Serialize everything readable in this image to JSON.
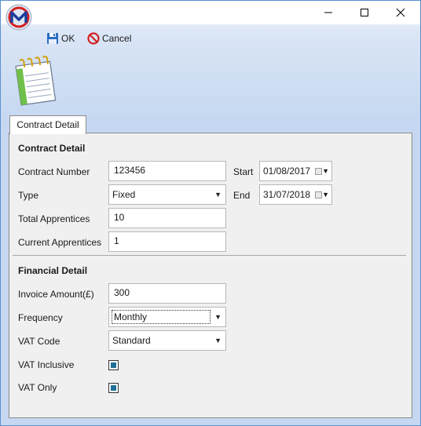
{
  "window": {
    "tab_label": "Contract Detail"
  },
  "toolbar": {
    "ok_label": "OK",
    "cancel_label": "Cancel"
  },
  "contract": {
    "section_title": "Contract Detail",
    "number_label": "Contract Number",
    "number_value": "123456",
    "type_label": "Type",
    "type_value": "Fixed",
    "total_label": "Total Apprentices",
    "total_value": "10",
    "current_label": "Current Apprentices",
    "current_value": "1",
    "start_label": "Start",
    "start_value": "01/08/2017",
    "end_label": "End",
    "end_value": "31/07/2018"
  },
  "financial": {
    "section_title": "Financial Detail",
    "invoice_label": "Invoice Amount(£)",
    "invoice_value": "300",
    "frequency_label": "Frequency",
    "frequency_value": "Monthly",
    "vat_code_label": "VAT Code",
    "vat_code_value": "Standard",
    "vat_inclusive_label": "VAT Inclusive",
    "vat_inclusive_checked": true,
    "vat_only_label": "VAT Only",
    "vat_only_checked": true
  },
  "icons": {
    "app": "app-logo-icon",
    "ok": "save-disk-icon",
    "cancel": "no-entry-icon",
    "header": "notepad-icon"
  },
  "colors": {
    "accent": "#1f6f99",
    "window_border": "#5a8fd0",
    "cancel_red": "#d42020",
    "disk_blue": "#2a6cc4"
  }
}
